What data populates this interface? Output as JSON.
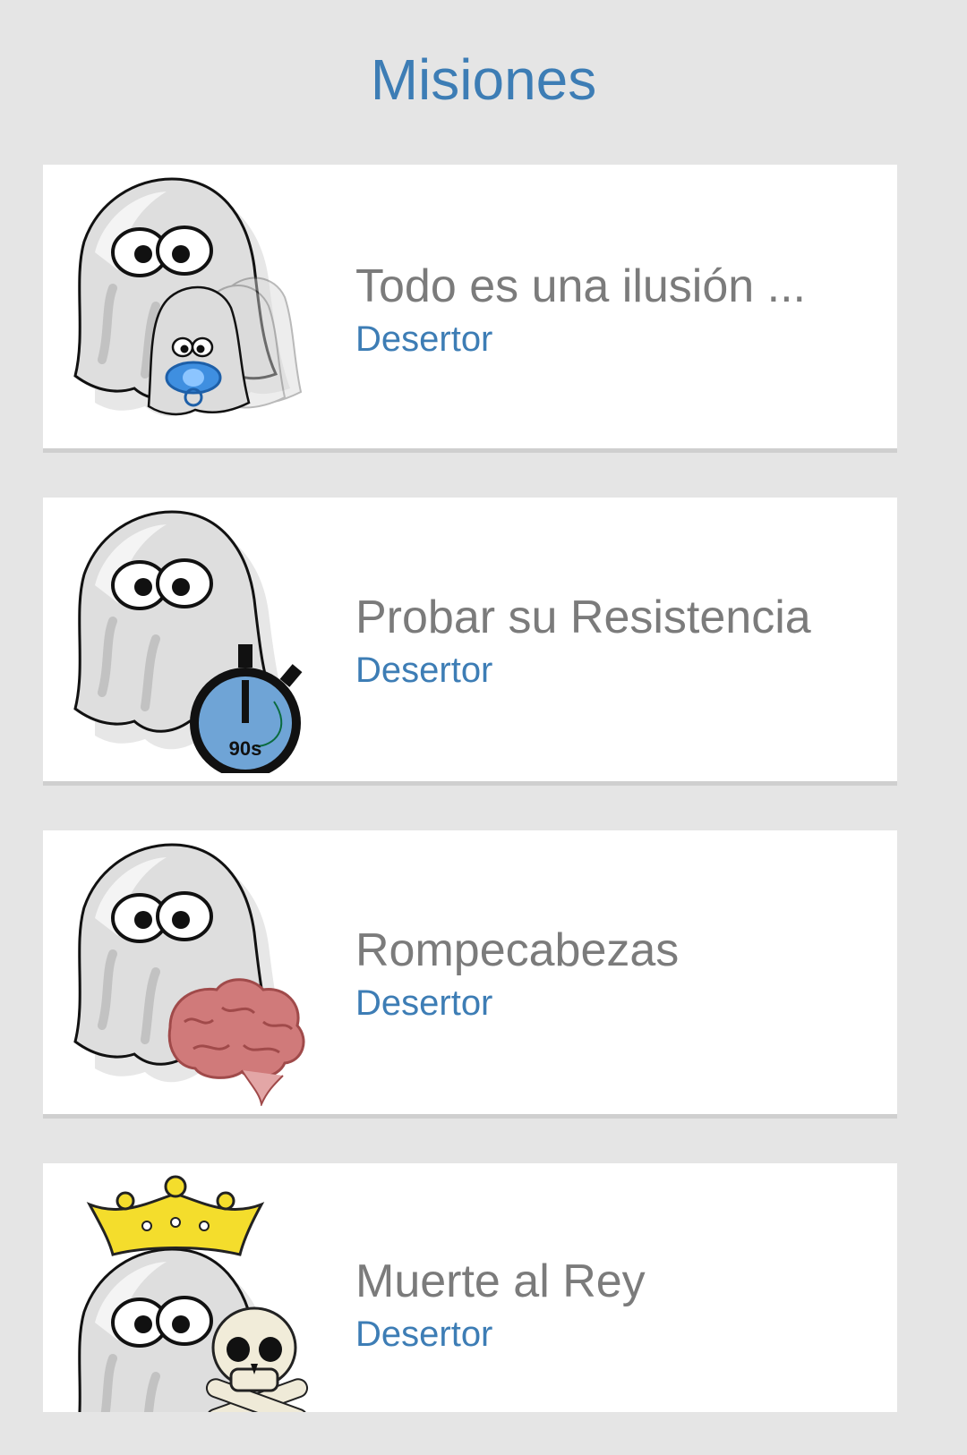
{
  "header": {
    "title": "Misiones"
  },
  "colors": {
    "background": "#e5e5e5",
    "card": "#ffffff",
    "accent": "#3d7db5",
    "mission_text": "#7b7b7b"
  },
  "missions": [
    {
      "name": "Todo es una ilusión ...",
      "rank": "Desertor",
      "icon": "ghost-clones-pacifier-icon"
    },
    {
      "name": "Probar su Resistencia",
      "rank": "Desertor",
      "icon": "ghost-stopwatch-icon",
      "timer_label": "90s"
    },
    {
      "name": "Rompecabezas",
      "rank": "Desertor",
      "icon": "ghost-brain-icon"
    },
    {
      "name": "Muerte al Rey",
      "rank": "Desertor",
      "icon": "ghost-crown-skull-icon"
    }
  ]
}
